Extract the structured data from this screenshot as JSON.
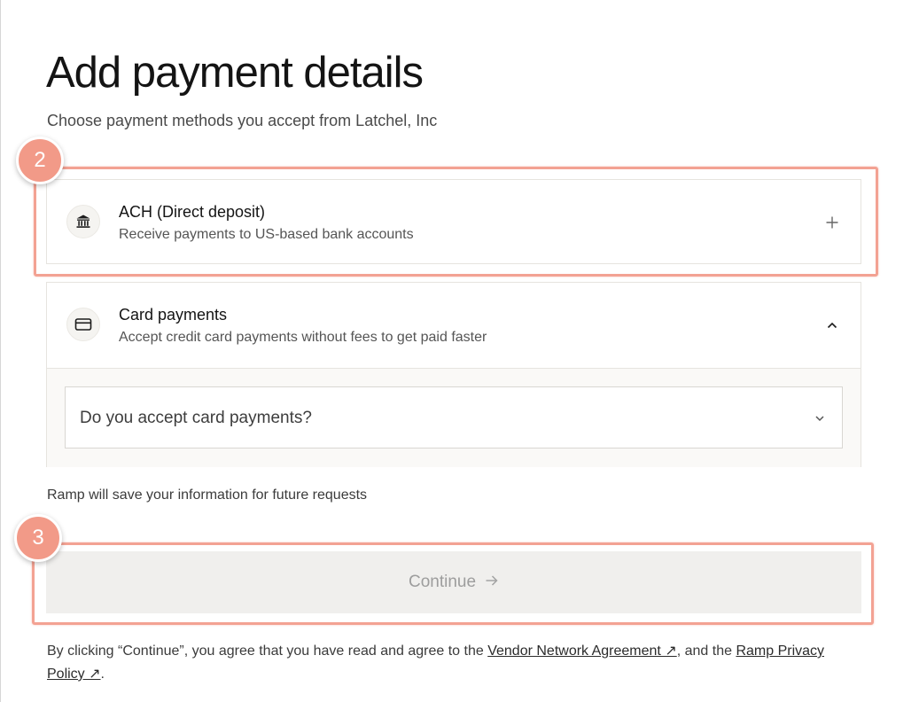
{
  "page": {
    "title": "Add payment details",
    "subtitle": "Choose payment methods you accept from Latchel, Inc"
  },
  "methods": [
    {
      "title": "ACH (Direct deposit)",
      "description": "Receive payments to US-based bank accounts",
      "icon": "bank-icon",
      "action_icon": "plus-icon",
      "expanded": false
    },
    {
      "title": "Card payments",
      "description": "Accept credit card payments without fees to get paid faster",
      "icon": "credit-card-icon",
      "action_icon": "chevron-up-icon",
      "expanded": true,
      "question": {
        "placeholder": "Do you accept card payments?",
        "icon": "chevron-down-icon"
      }
    }
  ],
  "save_note": "Ramp will save your information for future requests",
  "continue": {
    "label": "Continue",
    "icon": "arrow-right-icon",
    "enabled": false
  },
  "legal": {
    "prefix": "By clicking “Continue”, you agree that you have read and agree to the ",
    "link1": "Vendor Network Agreement ↗",
    "middle": ", and the ",
    "link2": "Ramp Privacy Policy ↗",
    "suffix": "."
  },
  "annotations": [
    {
      "number": "2"
    },
    {
      "number": "3"
    }
  ],
  "colors": {
    "annotation": "#f3a293",
    "badge": "#f29a88",
    "button_bg": "#f0efed",
    "button_text": "#9d9d9d"
  }
}
